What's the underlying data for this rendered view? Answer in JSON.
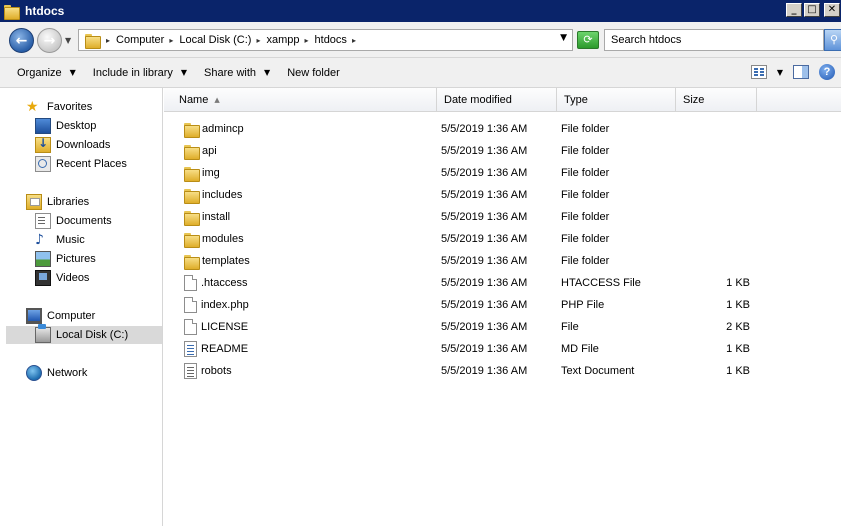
{
  "window": {
    "title": "htdocs"
  },
  "address": {
    "crumbs": [
      "Computer",
      "Local Disk (C:)",
      "xampp",
      "htdocs"
    ],
    "search_placeholder": "Search htdocs"
  },
  "toolbar": {
    "organize": "Organize",
    "include_in_library": "Include in library",
    "share_with": "Share with",
    "new_folder": "New folder"
  },
  "navpane": {
    "favorites": "Favorites",
    "desktop": "Desktop",
    "downloads": "Downloads",
    "recent_places": "Recent Places",
    "libraries": "Libraries",
    "documents": "Documents",
    "music": "Music",
    "pictures": "Pictures",
    "videos": "Videos",
    "computer": "Computer",
    "local_disk": "Local Disk (C:)",
    "network": "Network"
  },
  "columns": {
    "name": "Name",
    "date_modified": "Date modified",
    "type": "Type",
    "size": "Size"
  },
  "files": [
    {
      "name": "admincp",
      "date": "5/5/2019 1:36 AM",
      "type": "File folder",
      "size": "",
      "icon": "folder-icon"
    },
    {
      "name": "api",
      "date": "5/5/2019 1:36 AM",
      "type": "File folder",
      "size": "",
      "icon": "folder-icon"
    },
    {
      "name": "img",
      "date": "5/5/2019 1:36 AM",
      "type": "File folder",
      "size": "",
      "icon": "folder-icon"
    },
    {
      "name": "includes",
      "date": "5/5/2019 1:36 AM",
      "type": "File folder",
      "size": "",
      "icon": "folder-icon"
    },
    {
      "name": "install",
      "date": "5/5/2019 1:36 AM",
      "type": "File folder",
      "size": "",
      "icon": "folder-icon"
    },
    {
      "name": "modules",
      "date": "5/5/2019 1:36 AM",
      "type": "File folder",
      "size": "",
      "icon": "folder-icon"
    },
    {
      "name": "templates",
      "date": "5/5/2019 1:36 AM",
      "type": "File folder",
      "size": "",
      "icon": "folder-icon"
    },
    {
      "name": ".htaccess",
      "date": "5/5/2019 1:36 AM",
      "type": "HTACCESS File",
      "size": "1 KB",
      "icon": "file-icon"
    },
    {
      "name": "index.php",
      "date": "5/5/2019 1:36 AM",
      "type": "PHP File",
      "size": "1 KB",
      "icon": "file-icon"
    },
    {
      "name": "LICENSE",
      "date": "5/5/2019 1:36 AM",
      "type": "File",
      "size": "2 KB",
      "icon": "file-icon"
    },
    {
      "name": "README",
      "date": "5/5/2019 1:36 AM",
      "type": "MD File",
      "size": "1 KB",
      "icon": "md-file-icon"
    },
    {
      "name": "robots",
      "date": "5/5/2019 1:36 AM",
      "type": "Text Document",
      "size": "1 KB",
      "icon": "text-file-icon"
    }
  ]
}
